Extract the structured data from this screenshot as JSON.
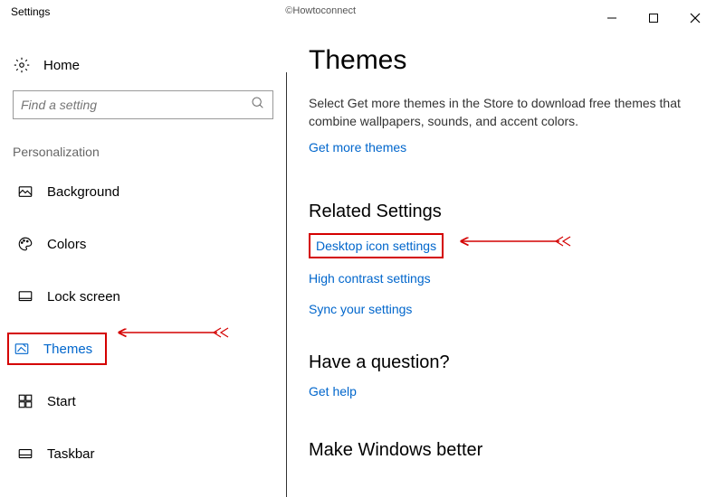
{
  "titlebar": {
    "title": "Settings",
    "watermark": "©Howtoconnect"
  },
  "sidebar": {
    "home_label": "Home",
    "search_placeholder": "Find a setting",
    "category": "Personalization",
    "items": [
      {
        "label": "Background"
      },
      {
        "label": "Colors"
      },
      {
        "label": "Lock screen"
      },
      {
        "label": "Themes"
      },
      {
        "label": "Start"
      },
      {
        "label": "Taskbar"
      }
    ]
  },
  "main": {
    "title": "Themes",
    "cutoff": "⁠",
    "description": "Select Get more themes in the Store to download free themes that combine wallpapers, sounds, and accent colors.",
    "get_more": "Get more themes",
    "related_heading": "Related Settings",
    "related_links": [
      "Desktop icon settings",
      "High contrast settings",
      "Sync your settings"
    ],
    "question_heading": "Have a question?",
    "get_help": "Get help",
    "better_heading": "Make Windows better"
  }
}
